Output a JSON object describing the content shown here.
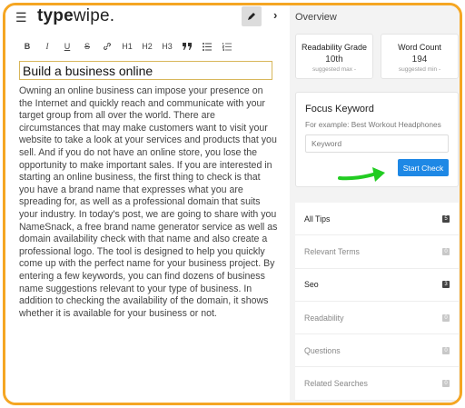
{
  "app": {
    "logo_prefix": "type",
    "logo_suffix": "wipe."
  },
  "toolbar": {
    "items": [
      {
        "name": "bold-button",
        "label": "B",
        "icon": "bold-icon"
      },
      {
        "name": "italic-button",
        "label": "I",
        "icon": "italic-icon"
      },
      {
        "name": "underline-button",
        "label": "U",
        "icon": "underline-icon"
      },
      {
        "name": "strikethrough-button",
        "label": "S",
        "icon": "strikethrough-icon"
      },
      {
        "name": "link-button",
        "label": "",
        "icon": "link-icon"
      },
      {
        "name": "heading1-button",
        "label": "H1",
        "icon": ""
      },
      {
        "name": "heading2-button",
        "label": "H2",
        "icon": ""
      },
      {
        "name": "heading3-button",
        "label": "H3",
        "icon": ""
      },
      {
        "name": "quote-button",
        "label": "",
        "icon": "quote-icon"
      },
      {
        "name": "bullet-list-button",
        "label": "",
        "icon": "bullet-list-icon"
      },
      {
        "name": "numbered-list-button",
        "label": "",
        "icon": "numbered-list-icon"
      }
    ]
  },
  "document": {
    "title": "Build a business online",
    "body": "Owning an online business can impose your presence on the Internet and quickly reach and communicate with your target group from all over the world. There are circumstances that may make customers want to visit your website to take a look at your services and products that you sell. And if you do not have an online store, you lose the opportunity to make important sales. If you are interested in starting an online business, the first thing to check is that you have a brand name that expresses what you are spreading for, as well as a professional domain that suits your industry. In today's post, we are going to share with you NameSnack, a free brand name generator service as well as domain availability check with that name and also create a professional logo. The tool is designed to help you quickly come up with the perfect name for your business project. By entering a few keywords, you can find dozens of business name suggestions relevant to your type of business. In addition to checking the availability of the domain, it shows whether it is available for your business or not."
  },
  "overview": {
    "title": "Overview",
    "readability": {
      "label": "Readability Grade",
      "value": "10th",
      "sub": "suggested max -"
    },
    "word_count": {
      "label": "Word Count",
      "value": "194",
      "sub": "suggested min -"
    },
    "focus": {
      "title": "Focus Keyword",
      "example": "For example: Best Workout Headphones",
      "placeholder": "Keyword",
      "button": "Start Check"
    },
    "tips": [
      {
        "label": "All Tips",
        "count": "5",
        "active": true
      },
      {
        "label": "Relevant Terms",
        "count": "0",
        "active": false
      },
      {
        "label": "Seo",
        "count": "3",
        "active": true
      },
      {
        "label": "Readability",
        "count": "0",
        "active": false
      },
      {
        "label": "Questions",
        "count": "0",
        "active": false
      },
      {
        "label": "Related Searches",
        "count": "0",
        "active": false
      }
    ]
  },
  "colors": {
    "frame": "#f5a623",
    "accent": "#1e88e5",
    "arrow": "#22cc22"
  }
}
